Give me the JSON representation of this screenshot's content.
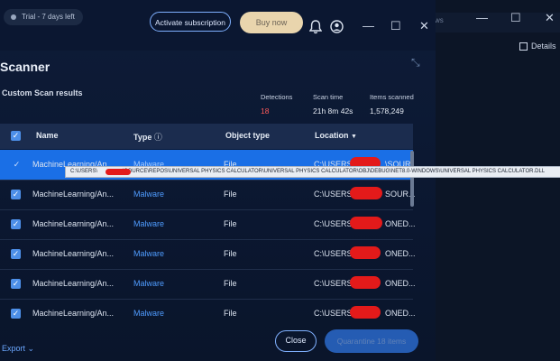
{
  "header": {
    "trial_badge": "Trial - 7 days left",
    "activate_label": "Activate subscription",
    "buy_label": "Buy now"
  },
  "scanner": {
    "title": "Scanner",
    "subtitle": "Custom Scan results",
    "stats": [
      {
        "label": "Detections",
        "value": "18"
      },
      {
        "label": "Scan time",
        "value": "21h 8m 42s"
      },
      {
        "label": "Items scanned",
        "value": "1,578,249"
      }
    ]
  },
  "table": {
    "columns": {
      "name": "Name",
      "type": "Type",
      "object": "Object type",
      "location": "Location"
    },
    "rows": [
      {
        "name": "MachineLearning/An...",
        "type": "Malware",
        "object": "File",
        "loc_prefix": "C:\\USERS\\",
        "loc_suffix": "\\SOUR..."
      },
      {
        "name": "MachineLearning/An...",
        "type": "Malware",
        "object": "File",
        "loc_prefix": "C:\\USERS\\",
        "loc_suffix": "SOUR..."
      },
      {
        "name": "MachineLearning/An...",
        "type": "Malware",
        "object": "File",
        "loc_prefix": "C:\\USERS\\",
        "loc_suffix": "ONED..."
      },
      {
        "name": "MachineLearning/An...",
        "type": "Malware",
        "object": "File",
        "loc_prefix": "C:\\USERS\\",
        "loc_suffix": "ONED..."
      },
      {
        "name": "MachineLearning/An...",
        "type": "Malware",
        "object": "File",
        "loc_prefix": "C:\\USERS\\",
        "loc_suffix": "ONED..."
      },
      {
        "name": "MachineLearning/An...",
        "type": "Malware",
        "object": "File",
        "loc_prefix": "C:\\USERS\\",
        "loc_suffix": "ONED..."
      }
    ]
  },
  "tooltip": {
    "prefix": "C:\\USERS\\",
    "suffix": "\\SOURCE\\REPOS\\UNIVERSAL PHYSICS CALCULATOR\\UNIVERSAL PHYSICS CALCULATOR\\OBJ\\DEBUG\\NET8.0-WINDOWS\\UNIVERSAL PHYSICS CALCULATOR.DLL"
  },
  "footer": {
    "export_label": "Export",
    "close_label": "Close",
    "quarantine_label": "Quarantine 18 items"
  },
  "background_window": {
    "peek_text": "ws",
    "details_label": "Details"
  },
  "colors": {
    "accent": "#2e74e0",
    "selected_row": "#1a6fe6",
    "malware": "#4f9cff",
    "detections": "#ff5a5a",
    "buy_button": "#e9d5ad"
  }
}
